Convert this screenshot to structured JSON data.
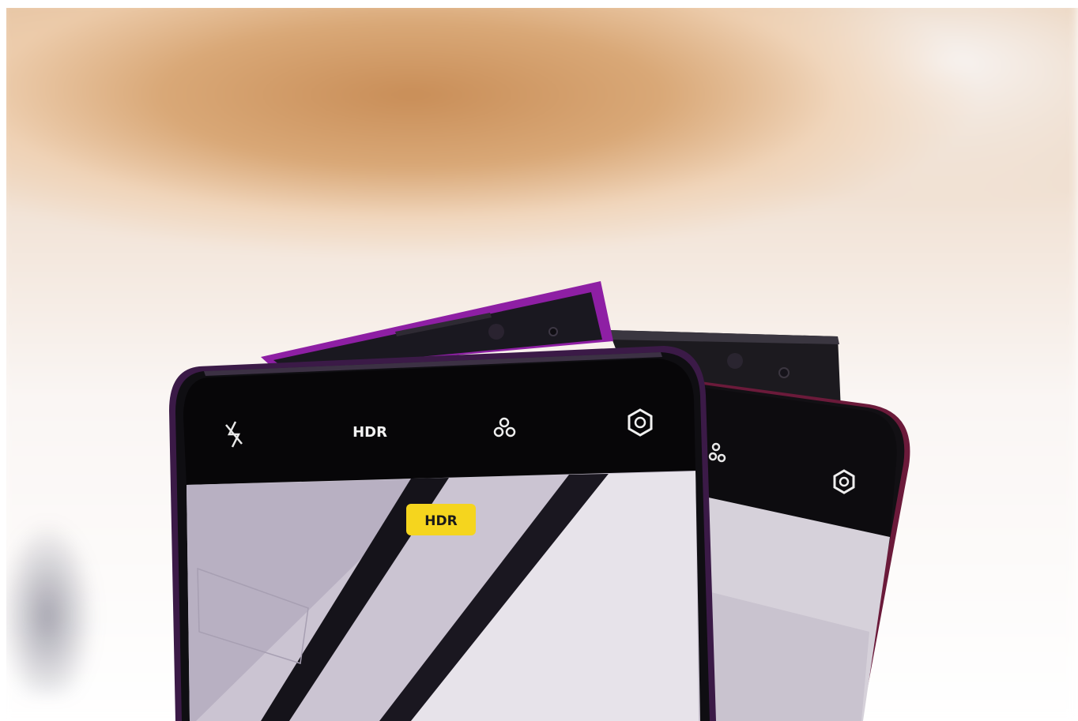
{
  "scene": {
    "description_icons": [
      "flash-off-icon",
      "filter-icon",
      "settings-icon"
    ],
    "front_phone": {
      "hdr_toolbar_label": "HDR",
      "hdr_badge_label": "HDR",
      "badge_color": "#f5d51e",
      "body_color": "#7a1f8c"
    },
    "back_phone": {
      "body_color": "#6b1a3a"
    }
  }
}
